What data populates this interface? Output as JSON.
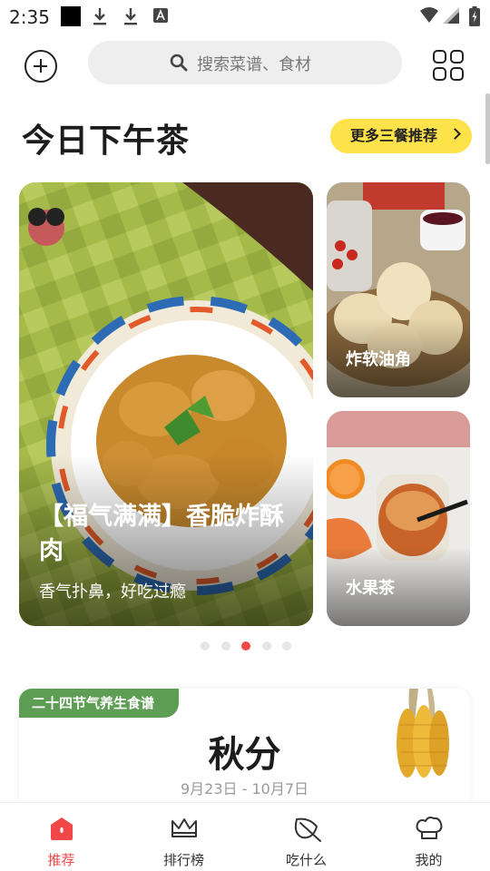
{
  "status_bar": {
    "time": "2:35",
    "icons": [
      "black-square-icon",
      "download-icon",
      "download-icon",
      "font-a-icon",
      "wifi-icon",
      "cellular-icon",
      "battery-icon"
    ]
  },
  "header": {
    "search_placeholder": "搜索菜谱、食材"
  },
  "section": {
    "title": "今日下午茶",
    "more_label": "更多三餐推荐"
  },
  "cards": {
    "main": {
      "title": "【福气满满】香脆炸酥肉",
      "subtitle": "香气扑鼻，好吃过瘾"
    },
    "side_top": {
      "label": "炸软油角"
    },
    "side_bottom": {
      "label": "水果茶"
    }
  },
  "pager": {
    "count": 5,
    "active_index": 2
  },
  "solar_term": {
    "tag": "二十四节气养生食谱",
    "name": "秋分",
    "dates": "9月23日 - 10月7日"
  },
  "nav": {
    "items": [
      {
        "label": "推荐",
        "icon": "home-icon",
        "active": true
      },
      {
        "label": "排行榜",
        "icon": "crown-icon",
        "active": false
      },
      {
        "label": "吃什么",
        "icon": "leaf-icon",
        "active": false
      },
      {
        "label": "我的",
        "icon": "chef-hat-icon",
        "active": false
      }
    ]
  },
  "colors": {
    "accent": "#f04848",
    "more_button": "#fde24a",
    "tag_green": "#5e9e54"
  }
}
